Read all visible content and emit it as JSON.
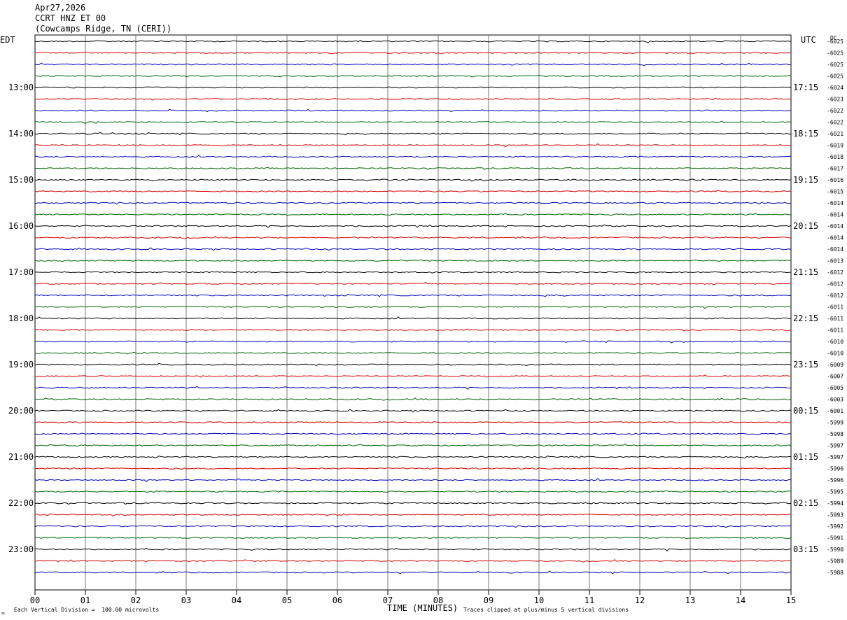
{
  "header": {
    "date": "Apr27,2026",
    "channel": "CCRT HNZ ET 00",
    "station": "(Cowcamps Ridge, TN (CERI))"
  },
  "left_zone": "EDT",
  "right_zone": "UTC",
  "dc_header": "DC",
  "footer": {
    "scale_note": "Each Vertical Division =  100.00 microvolts",
    "clip_note": "Traces clipped at plus/minus 5 vertical divisions",
    "xlabel": "TIME (MINUTES)"
  },
  "chart_data": {
    "type": "line",
    "title": "",
    "xlabel": "TIME (MINUTES)",
    "xlim": [
      0,
      15
    ],
    "x_ticks": [
      "00",
      "01",
      "02",
      "03",
      "04",
      "05",
      "06",
      "07",
      "08",
      "09",
      "10",
      "11",
      "12",
      "13",
      "14",
      "15"
    ],
    "trace_colors": [
      "#000000",
      "#dd0000",
      "#0000bb",
      "#006600"
    ],
    "left_hour_labels": [
      "13:00",
      "14:00",
      "15:00",
      "16:00",
      "17:00",
      "18:00",
      "19:00",
      "20:00",
      "21:00",
      "22:00",
      "23:00"
    ],
    "right_hour_labels": [
      "17:15",
      "18:15",
      "19:15",
      "20:15",
      "21:15",
      "22:15",
      "23:15",
      "00:15",
      "01:15",
      "02:15",
      "03:15"
    ],
    "dc_offsets": [
      "-6025",
      "-6025",
      "-6025",
      "-6025",
      "-6024",
      "-6023",
      "-6022",
      "-6022",
      "-6021",
      "-6019",
      "-6018",
      "-6017",
      "-6016",
      "-6015",
      "-6014",
      "-6014",
      "-6014",
      "-6014",
      "-6014",
      "-6013",
      "-6012",
      "-6012",
      "-6012",
      "-6011",
      "-6011",
      "-6011",
      "-6010",
      "-6010",
      "-6009",
      "-6007",
      "-6005",
      "-6003",
      "-6001",
      "-5999",
      "-5998",
      "-5997",
      "-5997",
      "-5996",
      "-5996",
      "-5995",
      "-5994",
      "-5993",
      "-5992",
      "-5991",
      "-5990",
      "-5989",
      "-5988"
    ]
  }
}
